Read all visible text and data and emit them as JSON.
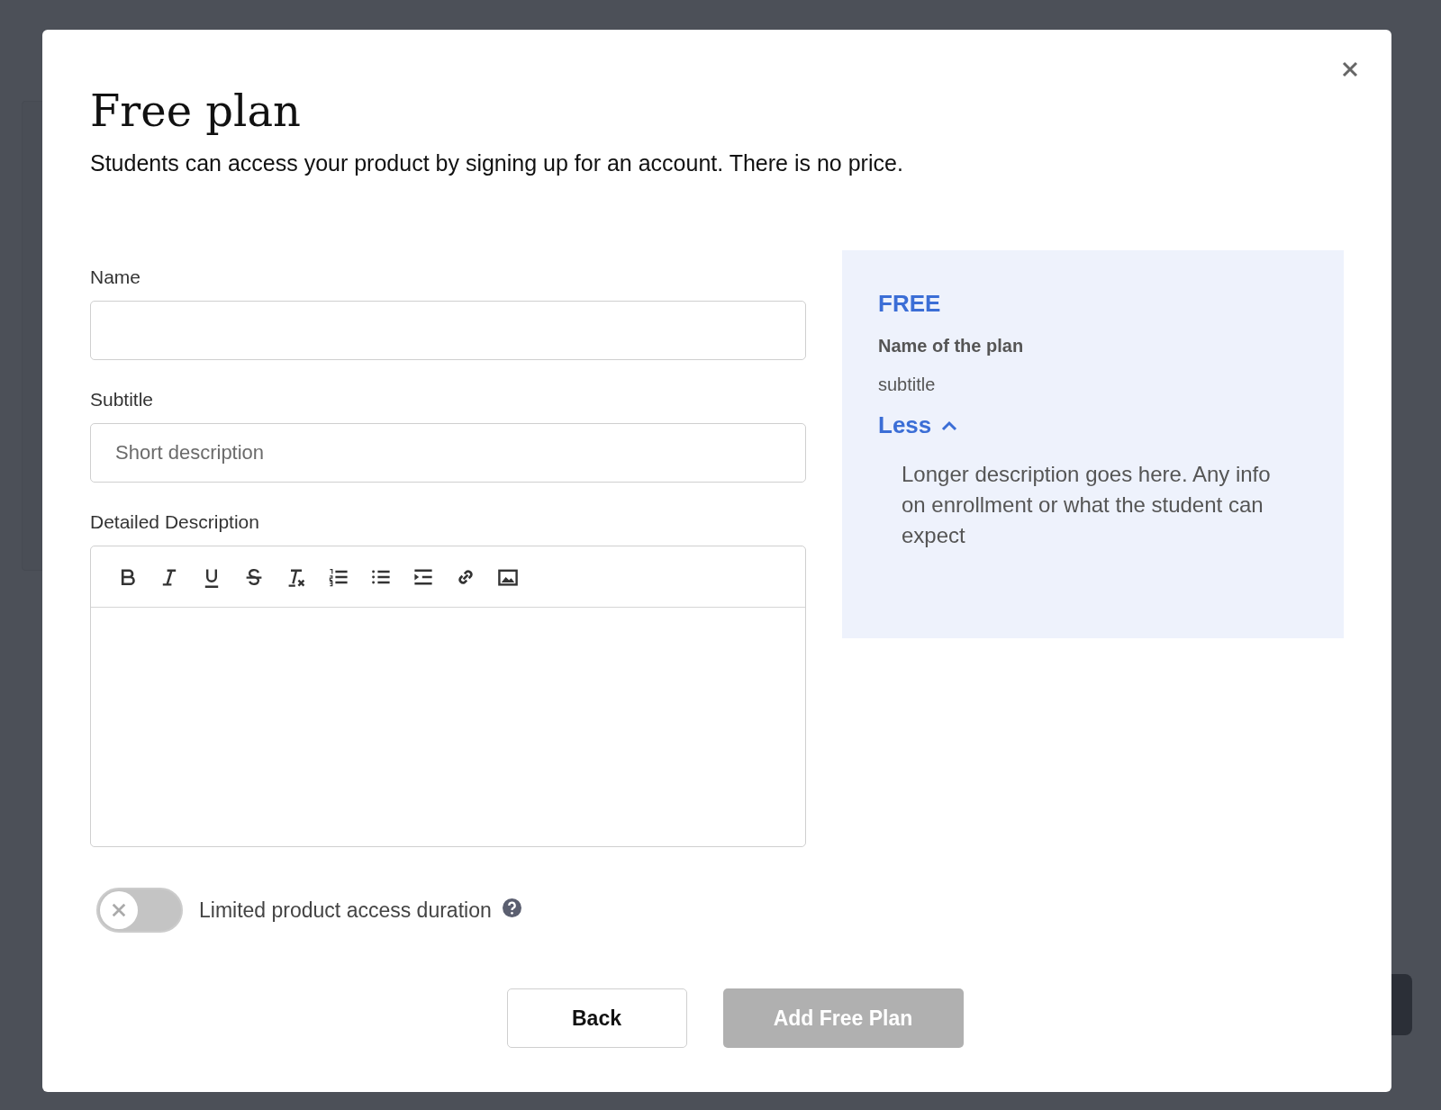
{
  "modal": {
    "title": "Free plan",
    "subtitle": "Students can access your product by signing up for an account. There is no price."
  },
  "fields": [
    {
      "label": "Name"
    },
    {
      "label": "Subtitle",
      "placeholder": "Short description"
    }
  ],
  "editor": {
    "label": "Detailed Description"
  },
  "access_toggle": {
    "label": "Limited product access duration",
    "on": false
  },
  "preview": {
    "badge": "FREE",
    "name": "Name of the plan",
    "subtitle": "subtitle",
    "toggle_label": "Less",
    "expanded": true,
    "description": "Longer description goes here. Any info on enrollment or what the student can expect"
  },
  "buttons": [
    {
      "label": "Back",
      "kind": "secondary",
      "disabled": false
    },
    {
      "label": "Add Free Plan",
      "kind": "primary",
      "disabled": true
    }
  ]
}
